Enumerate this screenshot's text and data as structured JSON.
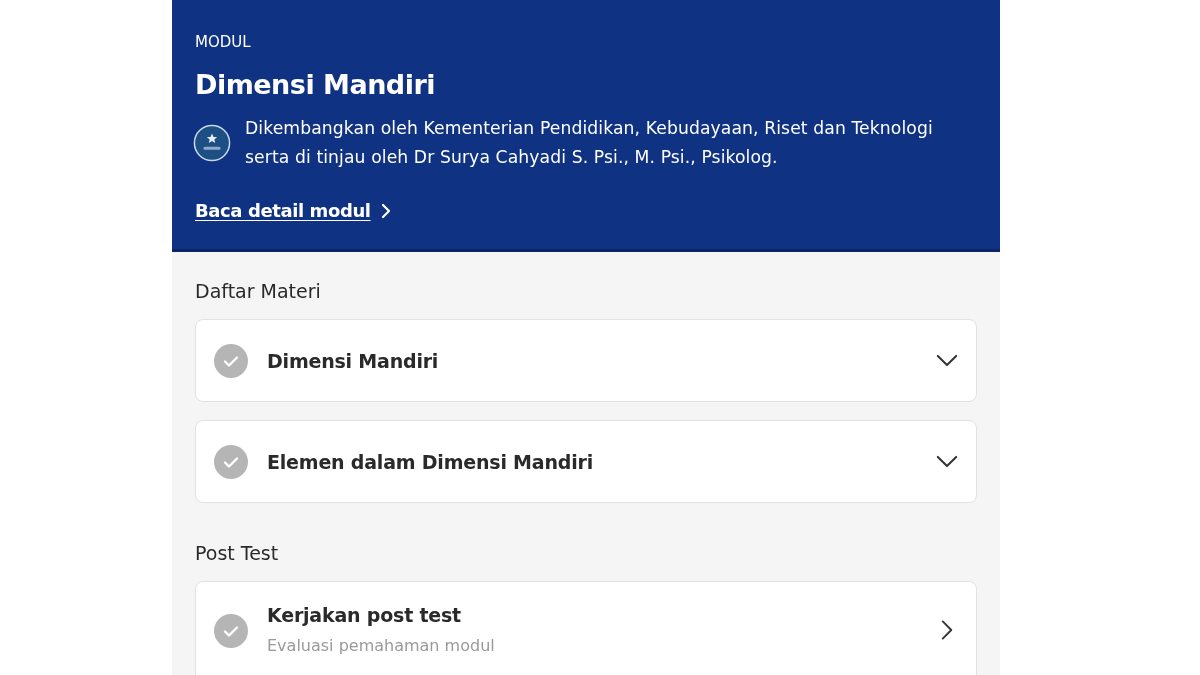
{
  "header": {
    "eyebrow": "MODUL",
    "title": "Dimensi Mandiri",
    "description": "Dikembangkan oleh Kementerian Pendidikan, Kebudayaan, Riset dan Teknologi serta di tinjau oleh Dr Surya Cahyadi S. Psi., M. Psi., Psikolog.",
    "link": "Baca detail modul"
  },
  "sections": [
    {
      "title": "Daftar Materi",
      "items": [
        {
          "kind": "accordion",
          "title": "Dimensi Mandiri",
          "completed": false,
          "expanded": false
        },
        {
          "kind": "accordion",
          "title": "Elemen dalam Dimensi Mandiri",
          "completed": false,
          "expanded": false
        }
      ]
    },
    {
      "title": "Post Test",
      "items": [
        {
          "kind": "link",
          "title": "Kerjakan post test",
          "subtitle": "Evaluasi pemahaman modul",
          "completed": false
        }
      ]
    }
  ]
}
